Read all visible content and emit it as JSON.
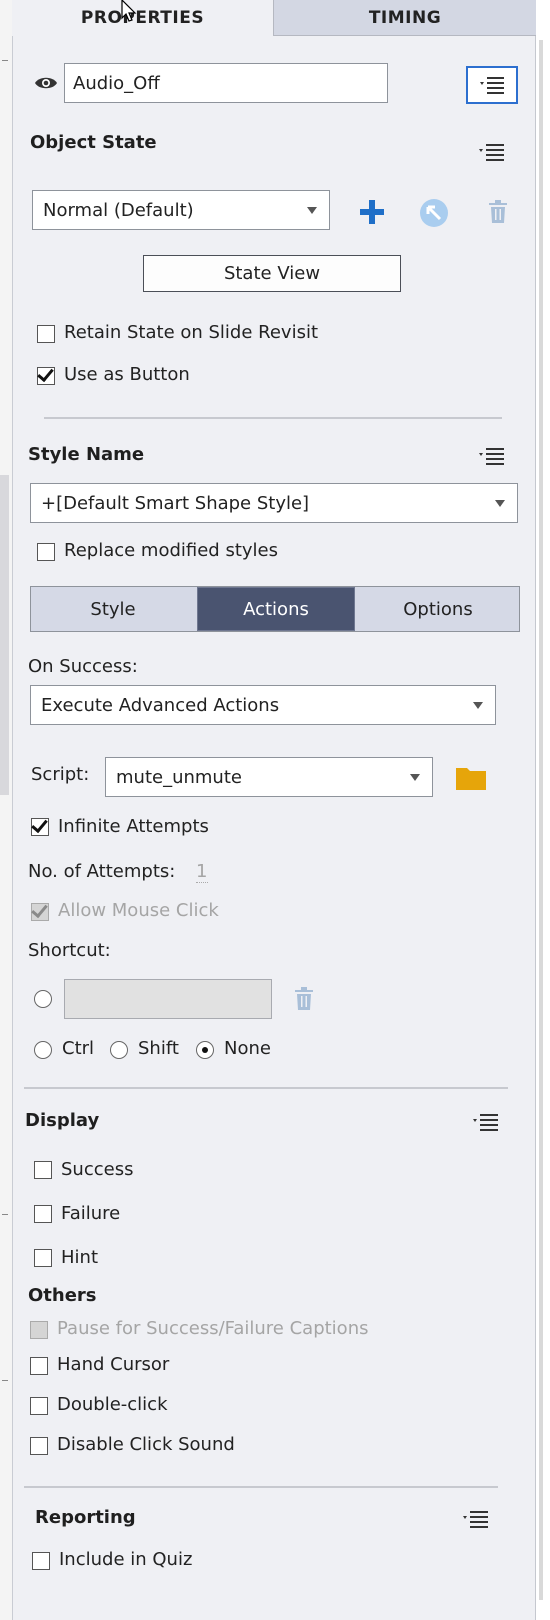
{
  "tabs": {
    "properties": "PROPERTIES",
    "timing": "TIMING"
  },
  "object": {
    "name": "Audio_Off"
  },
  "object_state": {
    "title": "Object State",
    "selected_state": "Normal (Default)",
    "state_view_label": "State View",
    "retain_state_label": "Retain State on Slide Revisit",
    "retain_state_checked": false,
    "use_as_button_label": "Use as Button",
    "use_as_button_checked": true
  },
  "style_name": {
    "title": "Style Name",
    "selected_style": "+[Default Smart Shape Style]",
    "replace_label": "Replace modified styles",
    "replace_checked": false
  },
  "subtabs": {
    "style": "Style",
    "actions": "Actions",
    "options": "Options",
    "active": "Actions"
  },
  "actions": {
    "on_success_label": "On Success:",
    "on_success_value": "Execute Advanced Actions",
    "script_label": "Script:",
    "script_value": "mute_unmute",
    "infinite_attempts_label": "Infinite Attempts",
    "infinite_attempts_checked": true,
    "attempts_label": "No. of Attempts:",
    "attempts_value": "1",
    "allow_mouse_click_label": "Allow Mouse Click",
    "shortcut_label": "Shortcut:",
    "modifiers": [
      {
        "label": "Ctrl",
        "selected": false
      },
      {
        "label": "Shift",
        "selected": false
      },
      {
        "label": "None",
        "selected": true
      }
    ]
  },
  "display": {
    "title": "Display",
    "items": [
      {
        "label": "Success",
        "checked": false
      },
      {
        "label": "Failure",
        "checked": false
      },
      {
        "label": "Hint",
        "checked": false
      }
    ]
  },
  "others": {
    "title": "Others",
    "pause_label": "Pause for Success/Failure Captions",
    "hand_cursor_label": "Hand Cursor",
    "double_click_label": "Double-click",
    "disable_click_sound_label": "Disable Click Sound"
  },
  "reporting": {
    "title": "Reporting",
    "include_in_quiz_label": "Include in Quiz",
    "include_in_quiz_checked": false
  },
  "colors": {
    "panel_bg": "#eff0f4",
    "active_tab_bg": "#4a5470",
    "accent_blue": "#1f6fc8",
    "folder_yellow": "#e6a50a"
  }
}
